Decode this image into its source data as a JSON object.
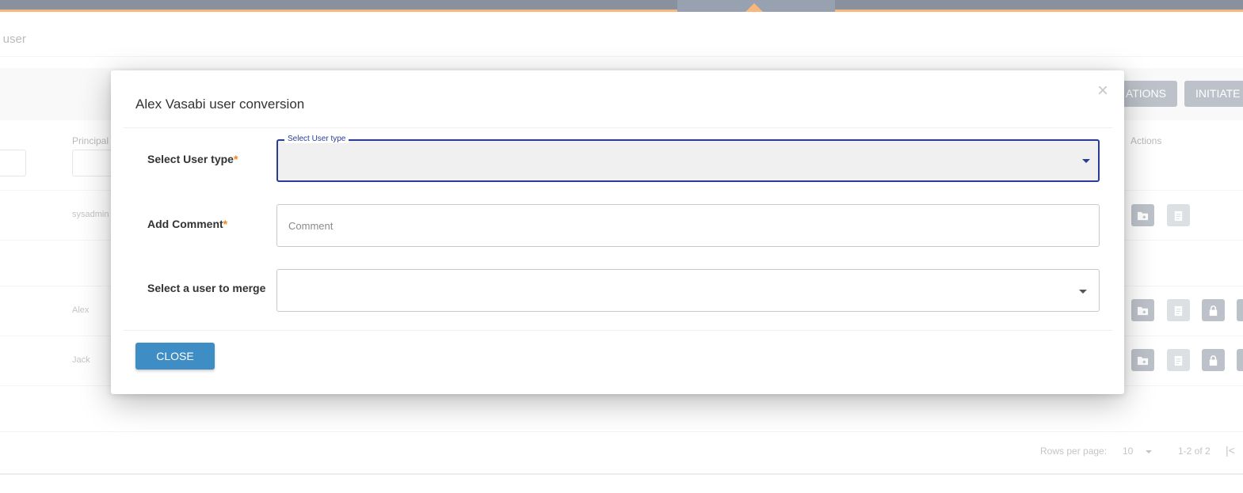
{
  "page": {
    "title": "s user",
    "toolbar": {
      "btn_1": "ATIONS",
      "btn_2": "INITIATE"
    },
    "table": {
      "headers": {
        "principal": "Principal",
        "actions": "Actions"
      },
      "rows": [
        {
          "principal": "sysadmin"
        },
        {
          "principal": "Alex"
        },
        {
          "principal": "Jack"
        }
      ]
    },
    "footer": {
      "rows_per_page_label": "Rows per page:",
      "rows_per_page_value": "10",
      "range": "1-2 of 2"
    }
  },
  "modal": {
    "title": "Alex Vasabi user conversion",
    "close_icon": "×",
    "fields": {
      "user_type": {
        "label": "Select User type",
        "required_mark": "*",
        "floating_label": "Select User type",
        "value": ""
      },
      "comment": {
        "label": "Add Comment",
        "required_mark": "*",
        "placeholder": "Comment",
        "value": ""
      },
      "merge_user": {
        "label": "Select a user to merge",
        "value": ""
      }
    },
    "close_button": "CLOSE"
  }
}
